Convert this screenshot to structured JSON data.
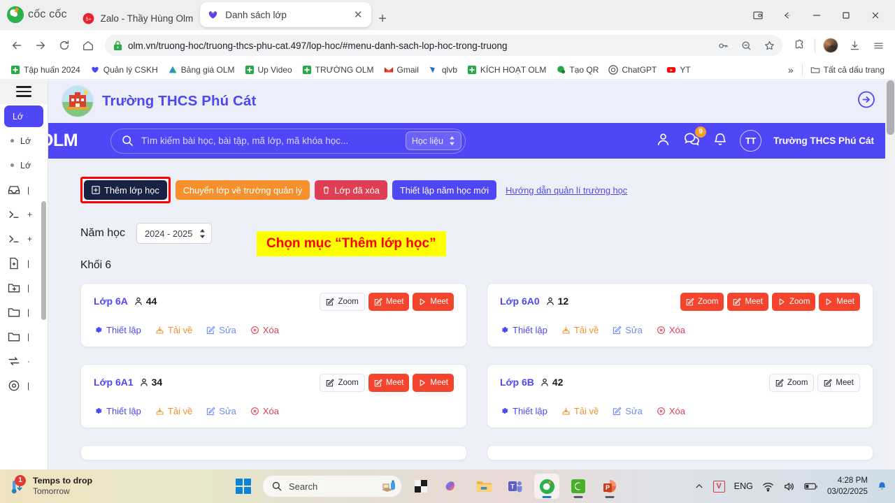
{
  "browser": {
    "brand": "cốc cốc",
    "tabs": [
      {
        "title": "Zalo - Thầy Hùng Olm",
        "icon": "zalo-icon",
        "active": false
      },
      {
        "title": "Danh sách lớp",
        "icon": "olm-icon",
        "active": true
      }
    ],
    "tab_close_label": "✕",
    "new_tab_label": "+",
    "url": "olm.vn/truong-hoc/truong-thcs-phu-cat.497/lop-hoc/#menu-danh-sach-lop-hoc-trong-truong",
    "bookmarks": [
      {
        "label": "Tập huấn 2024",
        "icon": "drive-icon"
      },
      {
        "label": "Quản lý CSKH",
        "icon": "olm-icon"
      },
      {
        "label": "Bảng giá OLM",
        "icon": "drive-icon"
      },
      {
        "label": "Up Video",
        "icon": "drive-icon"
      },
      {
        "label": "TRƯỜNG OLM",
        "icon": "drive-icon"
      },
      {
        "label": "Gmail",
        "icon": "gmail-icon"
      },
      {
        "label": "qlvb",
        "icon": "vnpt-icon"
      },
      {
        "label": "KÍCH HOẠT OLM",
        "icon": "drive-icon"
      },
      {
        "label": "Tạo QR",
        "icon": "qr-icon"
      },
      {
        "label": "ChatGPT",
        "icon": "chatgpt-icon"
      },
      {
        "label": "YT",
        "icon": "youtube-icon"
      }
    ],
    "bookmarks_overflow": "»",
    "all_bookmarks_label": "Tất cả dấu trang"
  },
  "school_banner": {
    "name": "Trường THCS Phú Cát"
  },
  "app_header": {
    "logo_text": "OLM",
    "search_placeholder": "Tìm kiếm bài học, bài tập, mã lớp, mã khóa học...",
    "search_value": "",
    "filter_label": "Học liệu",
    "message_badge": "9",
    "avatar_initials": "TT",
    "user_name": "Trường THCS Phú Cát"
  },
  "sidebar": {
    "items": [
      {
        "label": "Lớ",
        "icon": "book-icon",
        "selected": true
      },
      {
        "label": "Lớ",
        "icon": "bullet-icon",
        "selected": false
      },
      {
        "label": "Lớ",
        "icon": "bullet-icon",
        "selected": false
      },
      {
        "label": "",
        "icon": "inbox-icon",
        "selected": false
      },
      {
        "label": "",
        "icon": "terminal-icon",
        "selected": false
      },
      {
        "label": "",
        "icon": "terminal-icon",
        "selected": false
      },
      {
        "label": "",
        "icon": "file-plus-icon",
        "selected": false
      },
      {
        "label": "",
        "icon": "folder-plus-icon",
        "selected": false
      },
      {
        "label": "",
        "icon": "folder-icon",
        "selected": false
      },
      {
        "label": "",
        "icon": "folder-icon",
        "selected": false
      },
      {
        "label": "",
        "icon": "sync-icon",
        "selected": false
      },
      {
        "label": "",
        "icon": "record-icon",
        "selected": false
      }
    ]
  },
  "toolbar": {
    "add_class_label": "Thêm lớp học",
    "transfer_label": "Chuyển lớp về trường quản lý",
    "deleted_label": "Lớp đã xóa",
    "new_year_label": "Thiết lập năm học mới",
    "guide_label": "Hướng dẫn quản lí trường học"
  },
  "filters": {
    "year_label": "Năm học",
    "year_value": "2024 - 2025"
  },
  "annotation": {
    "text": "Chọn mục “Thêm lớp học”",
    "bg": "#ffff00",
    "fg": "#ff0000"
  },
  "grade_heading": "Khối 6",
  "card_actions": {
    "settings": "Thiết lập",
    "download": "Tải về",
    "edit": "Sửa",
    "delete": "Xóa"
  },
  "classes": [
    {
      "name": "Lớp 6A",
      "students": "44",
      "buttons": [
        {
          "label": "Zoom",
          "icon": "edit-square-icon",
          "style": "ghost"
        },
        {
          "label": "Meet",
          "icon": "edit-square-icon",
          "style": "solid"
        },
        {
          "label": "Meet",
          "icon": "play-icon",
          "style": "solid"
        }
      ]
    },
    {
      "name": "Lớp 6A0",
      "students": "12",
      "buttons": [
        {
          "label": "Zoom",
          "icon": "edit-square-icon",
          "style": "solid"
        },
        {
          "label": "Meet",
          "icon": "edit-square-icon",
          "style": "solid"
        },
        {
          "label": "Zoom",
          "icon": "play-icon",
          "style": "solid"
        },
        {
          "label": "Meet",
          "icon": "play-icon",
          "style": "solid"
        }
      ]
    },
    {
      "name": "Lớp 6A1",
      "students": "34",
      "buttons": [
        {
          "label": "Zoom",
          "icon": "edit-square-icon",
          "style": "ghost"
        },
        {
          "label": "Meet",
          "icon": "edit-square-icon",
          "style": "solid"
        },
        {
          "label": "Meet",
          "icon": "play-icon",
          "style": "solid"
        }
      ]
    },
    {
      "name": "Lớp 6B",
      "students": "42",
      "buttons": [
        {
          "label": "Zoom",
          "icon": "edit-square-icon",
          "style": "ghost"
        },
        {
          "label": "Meet",
          "icon": "edit-square-icon",
          "style": "ghost"
        }
      ]
    }
  ],
  "taskbar": {
    "weather_title": "Temps to drop",
    "weather_sub": "Tomorrow",
    "weather_badge": "1",
    "search_placeholder": "Search",
    "language": "ENG",
    "time": "4:28 PM",
    "date": "03/02/2025",
    "apps": [
      {
        "name": "file-explorer-dark-icon",
        "running": false
      },
      {
        "name": "copilot-icon",
        "running": false
      },
      {
        "name": "file-explorer-icon",
        "running": false
      },
      {
        "name": "teams-icon",
        "running": false
      },
      {
        "name": "coccoc-icon",
        "running": true
      },
      {
        "name": "camtasia-icon",
        "running": true
      },
      {
        "name": "powerpoint-icon",
        "running": true
      }
    ],
    "vietkey_label": "V"
  }
}
